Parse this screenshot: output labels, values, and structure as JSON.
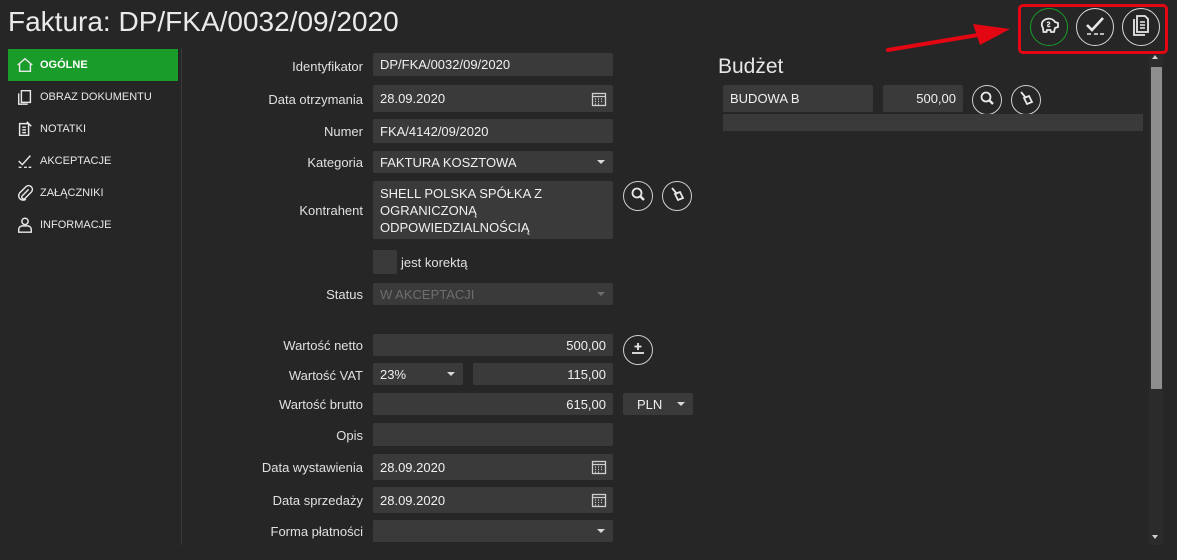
{
  "title": "Faktura: DP/FKA/0032/09/2020",
  "sidebar": {
    "items": [
      {
        "label": "OGÓLNE",
        "icon": "home-icon",
        "active": true
      },
      {
        "label": "OBRAZ DOKUMENTU",
        "icon": "document-image-icon"
      },
      {
        "label": "NOTATKI",
        "icon": "notes-icon"
      },
      {
        "label": "AKCEPTACJE",
        "icon": "checkmark-icon"
      },
      {
        "label": "ZAŁĄCZNIKI",
        "icon": "paperclip-icon"
      },
      {
        "label": "INFORMACJE",
        "icon": "user-info-icon"
      }
    ]
  },
  "form": {
    "identyfikator": {
      "label": "Identyfikator",
      "value": "DP/FKA/0032/09/2020"
    },
    "data_otrzymania": {
      "label": "Data otrzymania",
      "value": "28.09.2020"
    },
    "numer": {
      "label": "Numer",
      "value": "FKA/4142/09/2020"
    },
    "kategoria": {
      "label": "Kategoria",
      "value": "FAKTURA KOSZTOWA"
    },
    "kontrahent": {
      "label": "Kontrahent",
      "value": "SHELL POLSKA SPÓŁKA Z OGRANICZONĄ ODPOWIEDZIALNOŚCIĄ"
    },
    "jest_korekta": {
      "label": "jest korektą",
      "checked": false
    },
    "status": {
      "label": "Status",
      "value": "W AKCEPTACJI"
    },
    "wartosc_netto": {
      "label": "Wartość netto",
      "value": "500,00"
    },
    "wartosc_vat": {
      "label": "Wartość VAT",
      "rate": "23%",
      "value": "115,00"
    },
    "wartosc_brutto": {
      "label": "Wartość brutto",
      "value": "615,00",
      "currency": "PLN"
    },
    "opis": {
      "label": "Opis",
      "value": ""
    },
    "data_wystawienia": {
      "label": "Data wystawienia",
      "value": "28.09.2020"
    },
    "data_sprzedazy": {
      "label": "Data sprzedaży",
      "value": "28.09.2020"
    },
    "forma_platnosci": {
      "label": "Forma płatności",
      "value": ""
    }
  },
  "budzet": {
    "title": "Budżet",
    "name": "BUDOWA B",
    "amount": "500,00"
  },
  "toolbar": {
    "icons": [
      "piggy-bank-icon",
      "approve-icon",
      "document-icon"
    ]
  },
  "colors": {
    "background": "#262626",
    "field": "#3a3a3a",
    "accent": "#1a9c2a",
    "highlight": "#e30613"
  }
}
